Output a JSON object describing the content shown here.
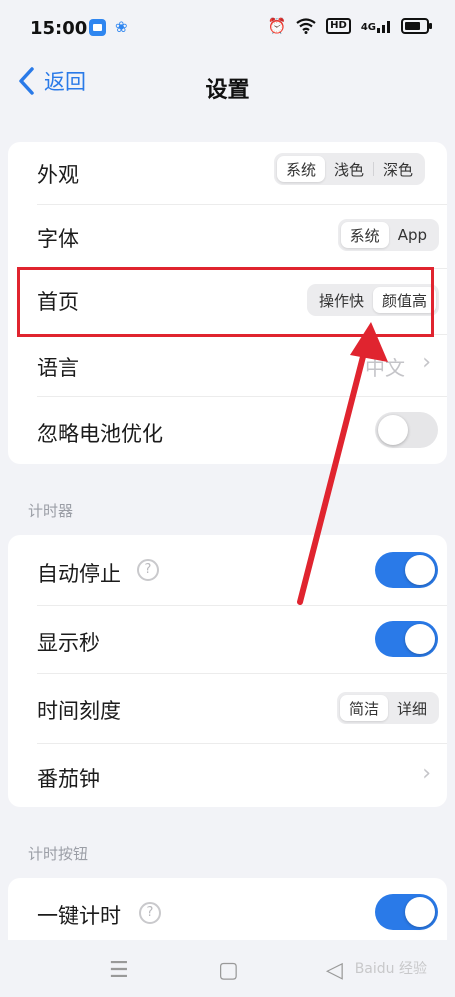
{
  "status_bar": {
    "time": "15:00",
    "hd_label": "HD",
    "network_label": "4G"
  },
  "header": {
    "back_label": "返回",
    "title": "设置"
  },
  "general": {
    "appearance": {
      "label": "外观",
      "options": [
        "系统",
        "浅色",
        "深色"
      ],
      "selected": "系统"
    },
    "font": {
      "label": "字体",
      "options": [
        "系统",
        "App"
      ],
      "selected": "系统"
    },
    "home": {
      "label": "首页",
      "options": [
        "操作快",
        "颜值高"
      ],
      "selected": "颜值高"
    },
    "language": {
      "label": "语言",
      "value": "中文"
    },
    "ignore_battery": {
      "label": "忽略电池优化",
      "enabled": false
    }
  },
  "timer": {
    "section_title": "计时器",
    "auto_stop": {
      "label": "自动停止",
      "enabled": true
    },
    "show_seconds": {
      "label": "显示秒",
      "enabled": true
    },
    "time_scale": {
      "label": "时间刻度",
      "options": [
        "简洁",
        "详细"
      ],
      "selected": "简洁"
    },
    "pomodoro": {
      "label": "番茄钟"
    }
  },
  "timer_buttons": {
    "section_title": "计时按钮",
    "one_tap_timer": {
      "label": "一键计时",
      "enabled": true
    }
  },
  "watermark": "Baidu 经验",
  "colors": {
    "accent": "#2a7ae8",
    "annotation": "#e0242f",
    "background": "#f2f3f7"
  }
}
